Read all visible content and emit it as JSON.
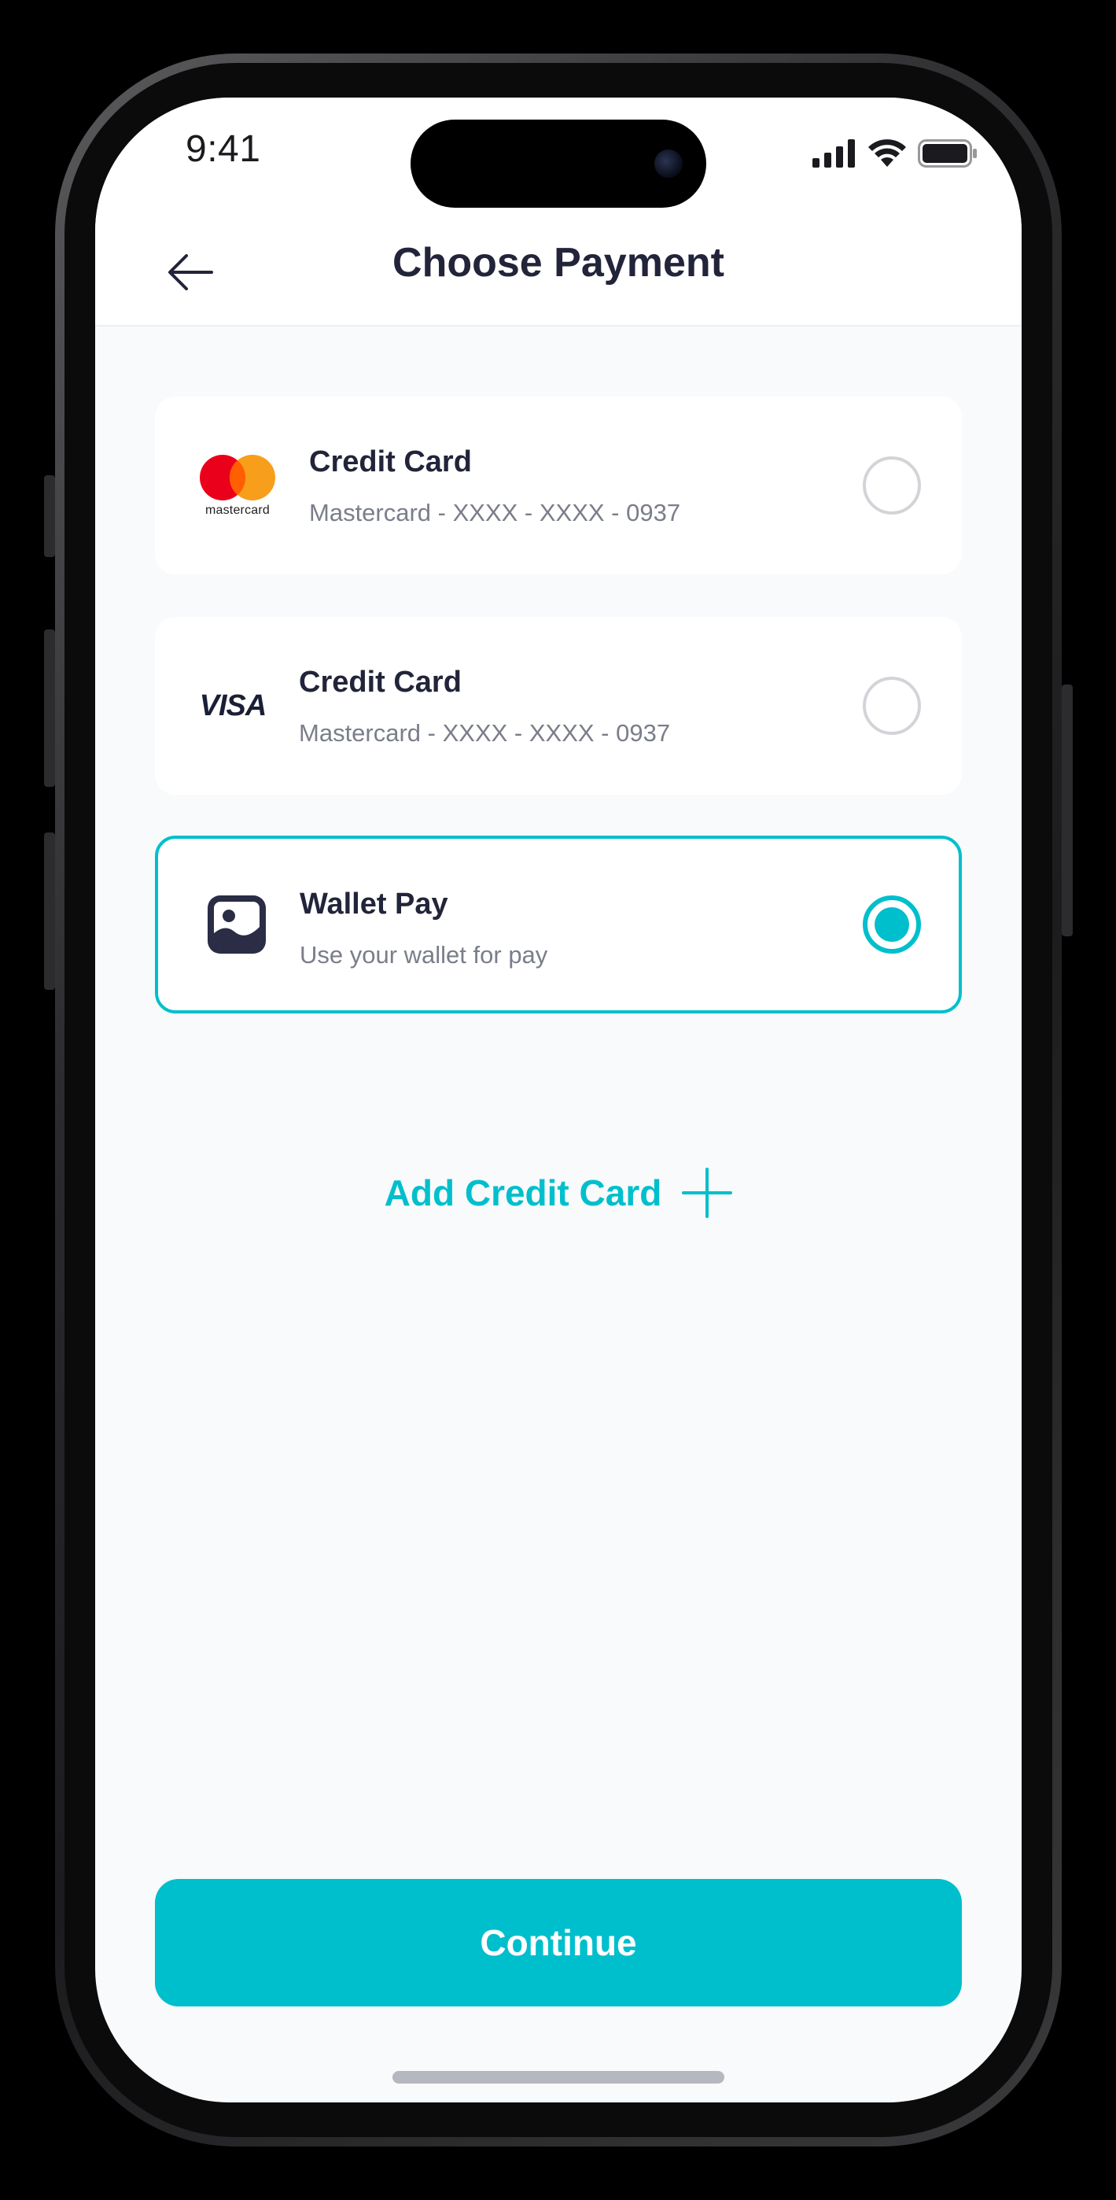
{
  "status_bar": {
    "time": "9:41"
  },
  "header": {
    "title": "Choose Payment"
  },
  "payment_methods": [
    {
      "logo": "mastercard-logo",
      "logo_text": "mastercard",
      "title": "Credit Card",
      "subtitle": "Mastercard - XXXX - XXXX  - 0937",
      "selected": false
    },
    {
      "logo": "visa-logo",
      "logo_text": "VISA",
      "title": "Credit Card",
      "subtitle": "Mastercard - XXXX - XXXX  - 0937",
      "selected": false
    },
    {
      "logo": "image-icon",
      "title": "Wallet Pay",
      "subtitle": "Use your wallet for pay",
      "selected": true
    }
  ],
  "add_card": {
    "label": "Add Credit Card"
  },
  "continue_button": {
    "label": "Continue"
  },
  "colors": {
    "accent": "#00bfcc",
    "title_text": "#22243a",
    "subtitle_text": "#7a7e8a",
    "background": "#f8fafb"
  }
}
